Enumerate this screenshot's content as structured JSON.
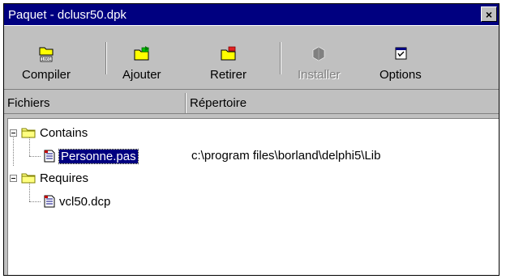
{
  "window": {
    "title": "Paquet - dclusr50.dpk",
    "close_glyph": "×"
  },
  "toolbar": {
    "buttons": [
      {
        "label": "Compiler",
        "icon": "compile-icon",
        "enabled": true
      },
      {
        "label": "Ajouter",
        "icon": "add-icon",
        "enabled": true
      },
      {
        "label": "Retirer",
        "icon": "remove-icon",
        "enabled": true
      },
      {
        "label": "Installer",
        "icon": "install-icon",
        "enabled": false
      },
      {
        "label": "Options",
        "icon": "options-icon",
        "enabled": true
      }
    ]
  },
  "columns": {
    "files": "Fichiers",
    "directory": "Répertoire"
  },
  "tree": {
    "contains": {
      "label": "Contains",
      "items": [
        {
          "name": "Personne.pas",
          "path": "c:\\program files\\borland\\delphi5\\Lib",
          "selected": true
        }
      ]
    },
    "requires": {
      "label": "Requires",
      "items": [
        {
          "name": "vcl50.dcp",
          "path": ""
        }
      ]
    }
  },
  "colors": {
    "titlebar": "#000080",
    "face": "#c0c0c0",
    "selection": "#000080"
  }
}
